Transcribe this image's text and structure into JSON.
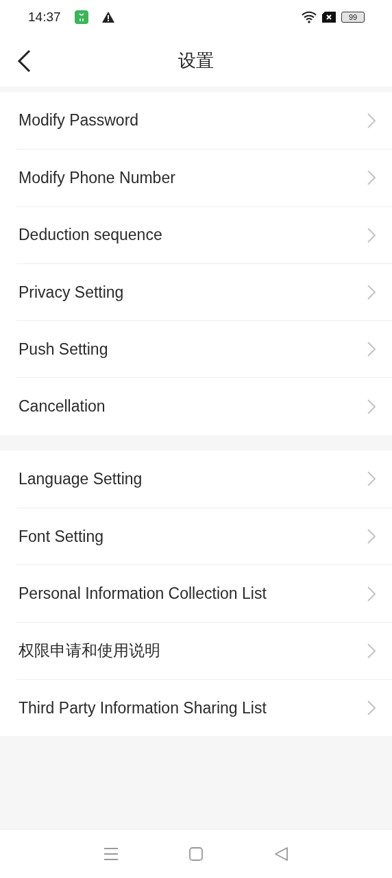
{
  "status_bar": {
    "time": "14:37",
    "battery": "99"
  },
  "header": {
    "title": "设置"
  },
  "groups": [
    {
      "items": [
        {
          "label": "Modify Password"
        },
        {
          "label": "Modify Phone Number"
        },
        {
          "label": "Deduction sequence"
        },
        {
          "label": "Privacy Setting"
        },
        {
          "label": "Push Setting"
        },
        {
          "label": "Cancellation"
        }
      ]
    },
    {
      "items": [
        {
          "label": "Language Setting"
        },
        {
          "label": "Font Setting"
        },
        {
          "label": "Personal Information Collection List"
        },
        {
          "label": "权限申请和使用说明"
        },
        {
          "label": "Third Party Information Sharing List"
        }
      ]
    }
  ]
}
